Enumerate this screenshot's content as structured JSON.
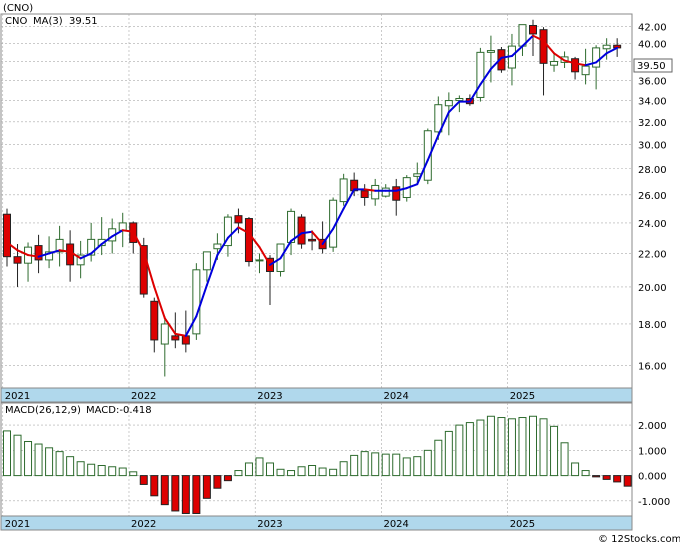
{
  "title": "(CNO)",
  "legend": {
    "ticker": "CNO",
    "ma_label": "MA(3)",
    "ma_value": "39.51"
  },
  "last_price": "39.50",
  "watermark": "© 12Stocks.com",
  "macd_legend": {
    "label": "MACD(26,12,9)",
    "value": "MACD:-0.418"
  },
  "colors": {
    "up": "#2e6b2e",
    "down": "#dd0000",
    "ma_up": "#0000dd",
    "ma_down": "#dd0000",
    "axis_band": "#b0d8ec",
    "grid": "#aaaaaa"
  },
  "chart_data": [
    {
      "type": "candlestick",
      "title": "(CNO)",
      "period": "monthly",
      "x_tick_labels": [
        "2021",
        "2022",
        "2023",
        "2024",
        "2025"
      ],
      "y_tick_labels": [
        "16.00",
        "18.00",
        "20.00",
        "22.00",
        "24.00",
        "26.00",
        "28.00",
        "30.00",
        "32.00",
        "34.00",
        "36.00",
        "38.00",
        "40.00",
        "42.00"
      ],
      "ylim": [
        15,
        43.5
      ],
      "y_scale": "log",
      "legend_position": "top-left",
      "series": [
        {
          "name": "CNO",
          "ohlc": [
            [
              24.6,
              25.0,
              21.2,
              21.8
            ],
            [
              21.8,
              22.6,
              20.0,
              21.4
            ],
            [
              21.4,
              22.7,
              20.3,
              22.4
            ],
            [
              22.5,
              23.2,
              20.8,
              21.6
            ],
            [
              21.6,
              23.1,
              21.1,
              22.1
            ],
            [
              22.1,
              23.8,
              21.2,
              22.9
            ],
            [
              22.6,
              23.5,
              20.3,
              21.3
            ],
            [
              21.3,
              22.8,
              20.5,
              21.9
            ],
            [
              21.9,
              24.0,
              21.5,
              22.9
            ],
            [
              22.5,
              24.4,
              21.9,
              22.9
            ],
            [
              22.8,
              24.3,
              22.0,
              23.6
            ],
            [
              23.5,
              24.7,
              22.4,
              24.0
            ],
            [
              24.0,
              24.1,
              22.0,
              22.7
            ],
            [
              22.5,
              23.0,
              19.4,
              19.6
            ],
            [
              19.2,
              19.4,
              16.6,
              17.2
            ],
            [
              17.0,
              18.4,
              15.5,
              18.0
            ],
            [
              17.4,
              18.6,
              16.8,
              17.2
            ],
            [
              17.4,
              18.7,
              16.6,
              17.0
            ],
            [
              17.5,
              21.4,
              17.2,
              21.0
            ],
            [
              21.0,
              22.1,
              20.3,
              22.1
            ],
            [
              22.3,
              23.3,
              21.6,
              22.6
            ],
            [
              22.5,
              24.6,
              21.8,
              24.4
            ],
            [
              24.5,
              25.0,
              23.3,
              24.0
            ],
            [
              24.3,
              24.4,
              21.2,
              21.5
            ],
            [
              21.6,
              22.0,
              20.8,
              21.6
            ],
            [
              21.7,
              21.9,
              19.0,
              20.9
            ],
            [
              20.9,
              22.6,
              20.6,
              22.6
            ],
            [
              22.7,
              25.0,
              21.9,
              24.8
            ],
            [
              24.4,
              24.6,
              22.3,
              22.6
            ],
            [
              22.9,
              23.5,
              22.2,
              22.8
            ],
            [
              22.9,
              24.1,
              22.0,
              22.3
            ],
            [
              22.4,
              25.8,
              22.1,
              25.6
            ],
            [
              25.5,
              27.6,
              25.2,
              27.2
            ],
            [
              27.1,
              27.7,
              25.9,
              26.3
            ],
            [
              26.3,
              26.8,
              25.2,
              25.8
            ],
            [
              25.7,
              27.2,
              25.2,
              26.7
            ],
            [
              25.9,
              26.8,
              25.8,
              26.5
            ],
            [
              26.6,
              27.2,
              24.5,
              25.6
            ],
            [
              25.8,
              27.5,
              25.5,
              27.3
            ],
            [
              27.4,
              28.5,
              26.9,
              27.6
            ],
            [
              27.1,
              31.4,
              26.8,
              31.2
            ],
            [
              31.1,
              34.4,
              30.4,
              33.6
            ],
            [
              33.5,
              34.8,
              30.8,
              34.0
            ],
            [
              34.0,
              34.5,
              32.9,
              34.2
            ],
            [
              34.2,
              34.6,
              33.5,
              33.7
            ],
            [
              34.3,
              39.5,
              33.9,
              39.0
            ],
            [
              39.0,
              40.9,
              35.8,
              39.2
            ],
            [
              39.3,
              39.6,
              36.8,
              37.1
            ],
            [
              37.3,
              41.1,
              35.5,
              39.7
            ],
            [
              39.7,
              42.2,
              38.6,
              42.2
            ],
            [
              42.1,
              42.8,
              38.6,
              41.1
            ],
            [
              41.6,
              41.9,
              34.5,
              37.8
            ],
            [
              37.6,
              38.8,
              36.9,
              38.0
            ],
            [
              37.9,
              39.1,
              37.3,
              38.5
            ],
            [
              38.3,
              38.5,
              36.1,
              36.9
            ],
            [
              36.6,
              39.4,
              35.6,
              37.5
            ],
            [
              37.4,
              39.8,
              35.1,
              39.5
            ],
            [
              39.4,
              40.6,
              38.2,
              39.8
            ],
            [
              39.8,
              40.6,
              38.5,
              39.5
            ]
          ]
        },
        {
          "name": "MA(3)",
          "values": [
            22.7,
            22.2,
            21.9,
            21.8,
            22.0,
            22.2,
            22.1,
            21.7,
            22.0,
            22.6,
            23.1,
            23.5,
            23.4,
            22.1,
            20.0,
            18.3,
            17.5,
            17.4,
            18.4,
            20.1,
            21.9,
            23.0,
            23.7,
            23.3,
            22.4,
            21.3,
            21.7,
            22.8,
            23.3,
            23.4,
            22.6,
            23.6,
            25.0,
            26.4,
            26.4,
            26.3,
            26.3,
            26.3,
            26.5,
            26.8,
            28.7,
            30.8,
            32.9,
            33.9,
            33.9,
            35.6,
            37.2,
            38.4,
            38.6,
            39.7,
            40.9,
            40.3,
            38.9,
            38.1,
            37.8,
            37.6,
            37.9,
            38.9,
            39.5
          ]
        }
      ]
    },
    {
      "type": "bar",
      "title": "MACD(26,12,9)",
      "x_tick_labels": [
        "2021",
        "2022",
        "2023",
        "2024",
        "2025"
      ],
      "y_tick_labels": [
        "-1.000",
        "0.000",
        "1.000",
        "2.000"
      ],
      "ylim": [
        -1.6,
        2.4
      ],
      "series": [
        {
          "name": "MACD",
          "values": [
            1.77,
            1.6,
            1.35,
            1.25,
            1.1,
            0.95,
            0.75,
            0.55,
            0.45,
            0.4,
            0.35,
            0.3,
            0.15,
            -0.35,
            -0.8,
            -1.15,
            -1.4,
            -1.5,
            -1.5,
            -0.9,
            -0.5,
            -0.2,
            0.2,
            0.5,
            0.7,
            0.5,
            0.25,
            0.2,
            0.35,
            0.4,
            0.3,
            0.25,
            0.55,
            0.8,
            0.95,
            0.9,
            0.85,
            0.85,
            0.7,
            0.75,
            1.0,
            1.4,
            1.75,
            2.0,
            2.1,
            2.2,
            2.35,
            2.3,
            2.25,
            2.3,
            2.35,
            2.25,
            1.95,
            1.3,
            0.5,
            0.2,
            -0.05,
            -0.15,
            -0.25,
            -0.418
          ]
        }
      ]
    }
  ]
}
